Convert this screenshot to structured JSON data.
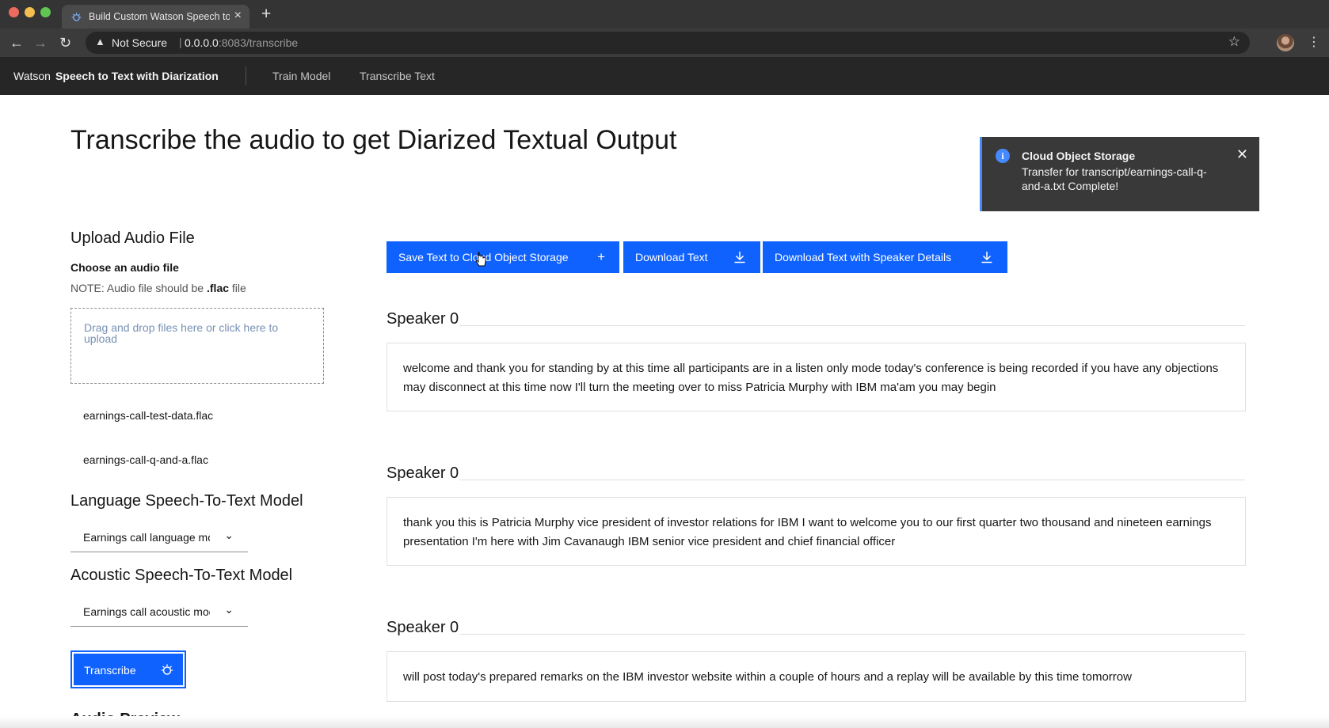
{
  "browser": {
    "tab_title": "Build Custom Watson Speech to Text",
    "tab_icon": "watson-icon",
    "security_label": "Not Secure",
    "url_host": "0.0.0.0",
    "url_rest": ":8083/transcribe"
  },
  "header": {
    "brand_prefix": "Watson",
    "brand_name": "Speech to Text with Diarization",
    "nav": [
      {
        "label": "Train Model"
      },
      {
        "label": "Transcribe Text"
      }
    ]
  },
  "page": {
    "title": "Transcribe the audio to get Diarized Textual Output"
  },
  "notification": {
    "title": "Cloud Object Storage",
    "body": "Transfer for transcript/earnings-call-q-and-a.txt Complete!",
    "icon": "info-icon"
  },
  "upload": {
    "heading": "Upload Audio File",
    "label": "Choose an audio file",
    "note_prefix": "NOTE: Audio file should be ",
    "note_ext": ".flac",
    "note_suffix": " file",
    "dropzone_text": "Drag and drop files here or click here to upload",
    "files": [
      {
        "name": "earnings-call-test-data.flac"
      },
      {
        "name": "earnings-call-q-and-a.flac"
      }
    ]
  },
  "language_model": {
    "heading": "Language Speech-To-Text Model",
    "selected": "Earnings call language model"
  },
  "acoustic_model": {
    "heading": "Acoustic Speech-To-Text Model",
    "selected": "Earnings call acoustic model"
  },
  "transcribe_button": {
    "label": "Transcribe"
  },
  "audio_preview": {
    "heading": "Audio Preview"
  },
  "actions": {
    "save_label": "Save Text to Cloud Object Storage",
    "download_label": "Download Text",
    "download_speaker_label": "Download Text with Speaker Details"
  },
  "transcripts": [
    {
      "speaker": "Speaker 0",
      "text": "welcome and thank you for standing by at this time all participants are in a listen only mode today's conference is being recorded if you have any objections may disconnect at this time now I'll turn the meeting over to miss Patricia Murphy with IBM ma'am you may begin"
    },
    {
      "speaker": "Speaker 0",
      "text": "thank you this is Patricia Murphy vice president of investor relations for IBM I want to welcome you to our first quarter two thousand and nineteen earnings presentation I'm here with Jim Cavanaugh IBM senior vice president and chief financial officer"
    },
    {
      "speaker": "Speaker 0",
      "text": "will post today's prepared remarks on the IBM investor website within a couple of hours and a replay will be available by this time tomorrow"
    }
  ],
  "colors": {
    "primary": "#0f62fe",
    "header_bg": "#262626",
    "toast_bg": "#393939",
    "info_blue": "#4589ff"
  }
}
